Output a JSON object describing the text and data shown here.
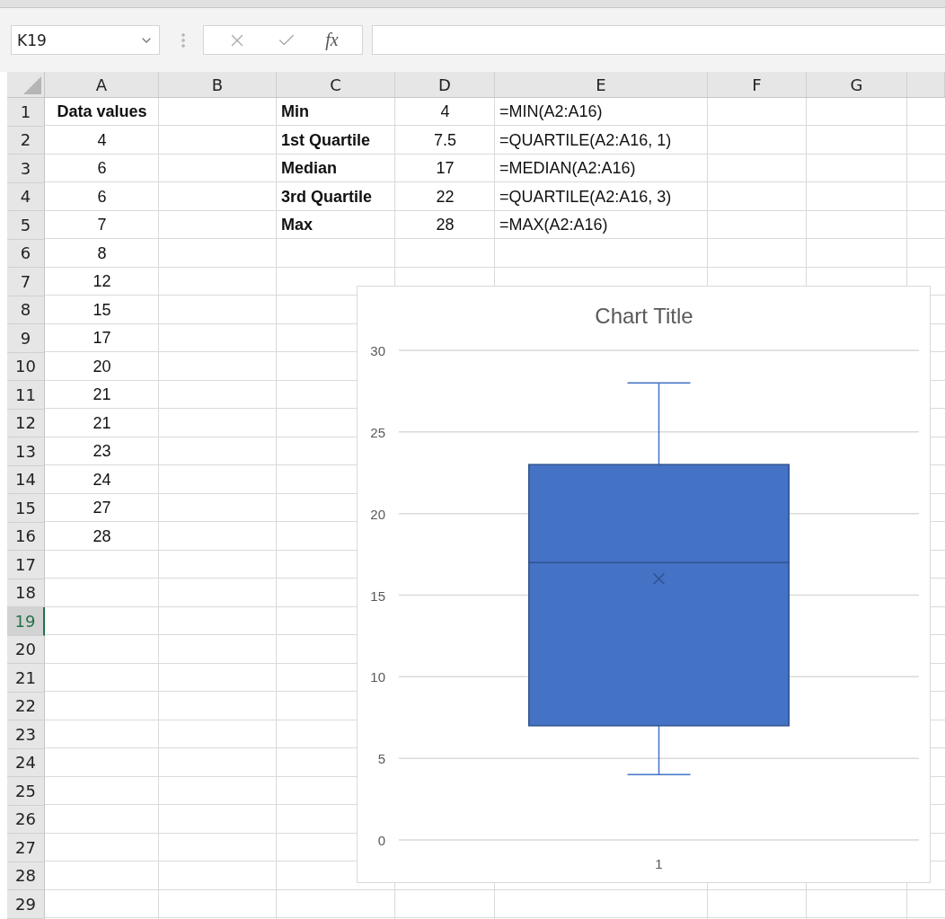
{
  "name_box": {
    "value": "K19"
  },
  "formula_bar": {
    "function_label": "fx"
  },
  "columns": [
    {
      "label": "A"
    },
    {
      "label": "B"
    },
    {
      "label": "C"
    },
    {
      "label": "D"
    },
    {
      "label": "E"
    },
    {
      "label": "F"
    },
    {
      "label": "G"
    }
  ],
  "rows": [
    {
      "label": "1",
      "selected": false,
      "cells": [
        {
          "text": "Data values",
          "bold": true
        },
        {},
        {
          "text": "Min",
          "bold": true
        },
        {
          "text": "4"
        },
        {
          "text": "=MIN(A2:A16)"
        }
      ]
    },
    {
      "label": "2",
      "selected": false,
      "cells": [
        {
          "text": "4"
        },
        {},
        {
          "text": "1st Quartile",
          "bold": true
        },
        {
          "text": "7.5"
        },
        {
          "text": "=QUARTILE(A2:A16, 1)"
        }
      ]
    },
    {
      "label": "3",
      "selected": false,
      "cells": [
        {
          "text": "6"
        },
        {},
        {
          "text": "Median",
          "bold": true
        },
        {
          "text": "17"
        },
        {
          "text": "=MEDIAN(A2:A16)"
        }
      ]
    },
    {
      "label": "4",
      "selected": false,
      "cells": [
        {
          "text": "6"
        },
        {},
        {
          "text": "3rd Quartile",
          "bold": true
        },
        {
          "text": "22"
        },
        {
          "text": "=QUARTILE(A2:A16, 3)"
        }
      ]
    },
    {
      "label": "5",
      "selected": false,
      "cells": [
        {
          "text": "7"
        },
        {},
        {
          "text": "Max",
          "bold": true
        },
        {
          "text": "28"
        },
        {
          "text": "=MAX(A2:A16)"
        }
      ]
    },
    {
      "label": "6",
      "selected": false,
      "cells": [
        {
          "text": "8"
        }
      ]
    },
    {
      "label": "7",
      "selected": false,
      "cells": [
        {
          "text": "12"
        }
      ]
    },
    {
      "label": "8",
      "selected": false,
      "cells": [
        {
          "text": "15"
        }
      ]
    },
    {
      "label": "9",
      "selected": false,
      "cells": [
        {
          "text": "17"
        }
      ]
    },
    {
      "label": "10",
      "selected": false,
      "cells": [
        {
          "text": "20"
        }
      ]
    },
    {
      "label": "11",
      "selected": false,
      "cells": [
        {
          "text": "21"
        }
      ]
    },
    {
      "label": "12",
      "selected": false,
      "cells": [
        {
          "text": "21"
        }
      ]
    },
    {
      "label": "13",
      "selected": false,
      "cells": [
        {
          "text": "23"
        }
      ]
    },
    {
      "label": "14",
      "selected": false,
      "cells": [
        {
          "text": "24"
        }
      ]
    },
    {
      "label": "15",
      "selected": false,
      "cells": [
        {
          "text": "27"
        }
      ]
    },
    {
      "label": "16",
      "selected": false,
      "cells": [
        {
          "text": "28"
        }
      ]
    },
    {
      "label": "17",
      "selected": false
    },
    {
      "label": "18",
      "selected": false
    },
    {
      "label": "19",
      "selected": true
    },
    {
      "label": "20",
      "selected": false
    },
    {
      "label": "21",
      "selected": false
    },
    {
      "label": "22",
      "selected": false
    },
    {
      "label": "23",
      "selected": false
    },
    {
      "label": "24",
      "selected": false
    },
    {
      "label": "25",
      "selected": false
    },
    {
      "label": "26",
      "selected": false
    },
    {
      "label": "27",
      "selected": false
    },
    {
      "label": "28",
      "selected": false
    },
    {
      "label": "29",
      "selected": false
    }
  ],
  "chart": {
    "chart_data": {
      "type": "box",
      "title": "Chart Title",
      "ylim": [
        0,
        30
      ],
      "yticks": [
        0,
        5,
        10,
        15,
        20,
        25,
        30
      ],
      "grid": true,
      "color": "#4472c4",
      "categories": [
        "1"
      ],
      "boxes": [
        {
          "low": 4,
          "q1": 7,
          "median": 17,
          "q3": 23,
          "high": 28,
          "mean": 16
        }
      ]
    }
  }
}
